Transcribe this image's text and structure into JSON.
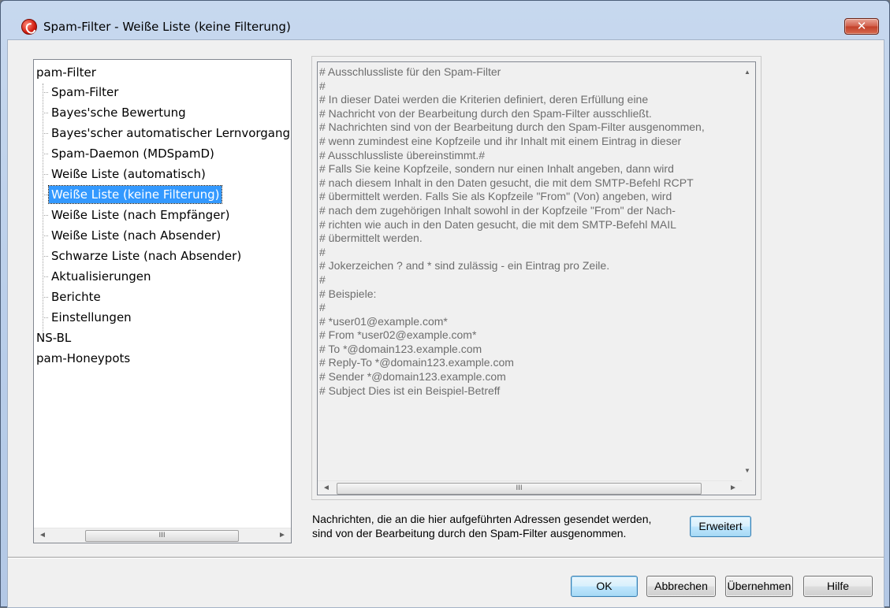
{
  "window": {
    "title": "Spam-Filter - Weiße Liste (keine Filterung)",
    "close_label": "✕",
    "accent": "#3399ff"
  },
  "tree": {
    "items": [
      {
        "label": "pam-Filter"
      },
      {
        "label": "Spam-Filter"
      },
      {
        "label": "Bayes'sche Bewertung"
      },
      {
        "label": "Bayes'scher automatischer Lernvorgang"
      },
      {
        "label": "Spam-Daemon (MDSpamD)"
      },
      {
        "label": "Weiße Liste (automatisch)"
      },
      {
        "label": "Weiße Liste (keine Filterung)",
        "selected": true
      },
      {
        "label": "Weiße Liste (nach Empfänger)"
      },
      {
        "label": "Weiße Liste (nach Absender)"
      },
      {
        "label": "Schwarze Liste (nach Absender)"
      },
      {
        "label": "Aktualisierungen"
      },
      {
        "label": "Berichte"
      },
      {
        "label": "Einstellungen"
      },
      {
        "label": "NS-BL"
      },
      {
        "label": "pam-Honeypots"
      }
    ],
    "scroll_left": "◄",
    "scroll_right": "►",
    "scroll_thumb_grip": "III"
  },
  "editor": {
    "text": "# Ausschlussliste für den Spam-Filter\n#\n# In dieser Datei werden die Kriterien definiert, deren Erfüllung eine\n# Nachricht von der Bearbeitung durch den Spam-Filter ausschließt.\n# Nachrichten sind von der Bearbeitung durch den Spam-Filter ausgenommen,\n# wenn zumindest eine Kopfzeile und ihr Inhalt mit einem Eintrag in dieser\n# Ausschlussliste übereinstimmt.#\n# Falls Sie keine Kopfzeile, sondern nur einen Inhalt angeben, dann wird\n# nach diesem Inhalt in den Daten gesucht, die mit dem SMTP-Befehl RCPT\n# übermittelt werden. Falls Sie als Kopfzeile \"From\" (Von) angeben, wird\n# nach dem zugehörigen Inhalt sowohl in der Kopfzeile \"From\" der Nach-\n# richten wie auch in den Daten gesucht, die mit dem SMTP-Befehl MAIL\n# übermittelt werden.\n#\n# Jokerzeichen ? and * sind zulässig - ein Eintrag pro Zeile.\n#\n# Beispiele:\n#\n# *user01@example.com*\n# From *user02@example.com*\n# To *@domain123.example.com\n# Reply-To *@domain123.example.com\n# Sender *@domain123.example.com\n# Subject Dies ist ein Beispiel-Betreff",
    "scroll_up": "▲",
    "scroll_down": "▼",
    "scroll_left": "◄",
    "scroll_right": "►",
    "scroll_thumb_grip": "III"
  },
  "info": {
    "line1": "Nachrichten, die an die hier aufgeführten Adressen gesendet werden,",
    "line2": "sind von der Bearbeitung durch den Spam-Filter ausgenommen."
  },
  "buttons": {
    "advanced": "Erweitert",
    "ok": "OK",
    "cancel": "Abbrechen",
    "apply": "Übernehmen",
    "help": "Hilfe"
  }
}
